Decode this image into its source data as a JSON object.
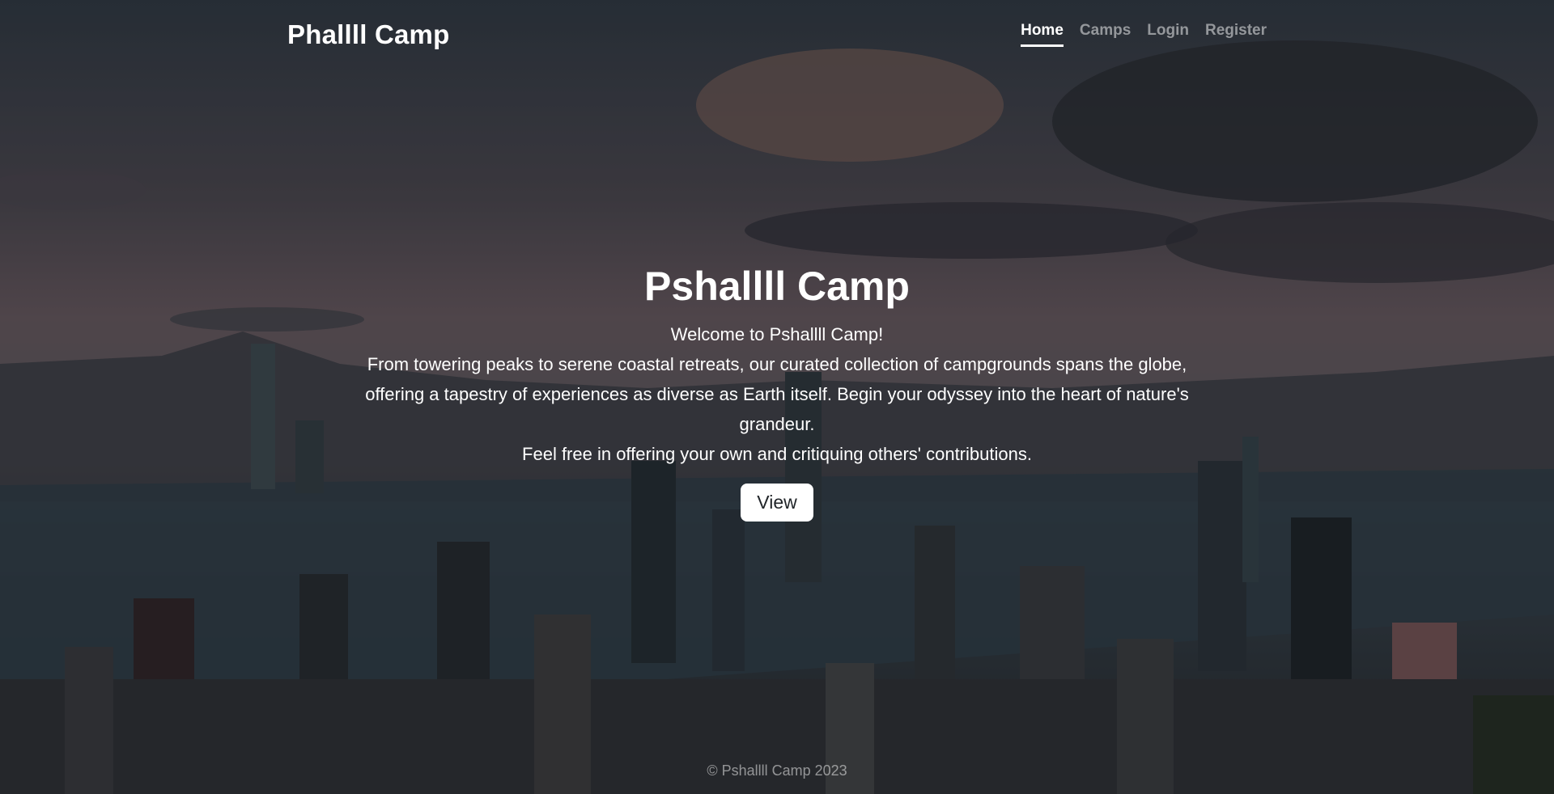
{
  "brand": "Phallll Camp",
  "nav": {
    "home": "Home",
    "camps": "Camps",
    "login": "Login",
    "register": "Register"
  },
  "hero": {
    "title": "Pshallll Camp",
    "welcome": "Welcome to Pshallll Camp!",
    "description": "From towering peaks to serene coastal retreats, our curated collection of campgrounds spans the globe, offering a tapestry of experiences as diverse as Earth itself. Begin your odyssey into the heart of nature's grandeur.",
    "invite": "Feel free in offering your own and critiquing others' contributions.",
    "button": "View"
  },
  "footer": "© Pshallll Camp 2023",
  "colors": {
    "overlay": "#000000",
    "text": "#ffffff",
    "button_bg": "#ffffff"
  }
}
